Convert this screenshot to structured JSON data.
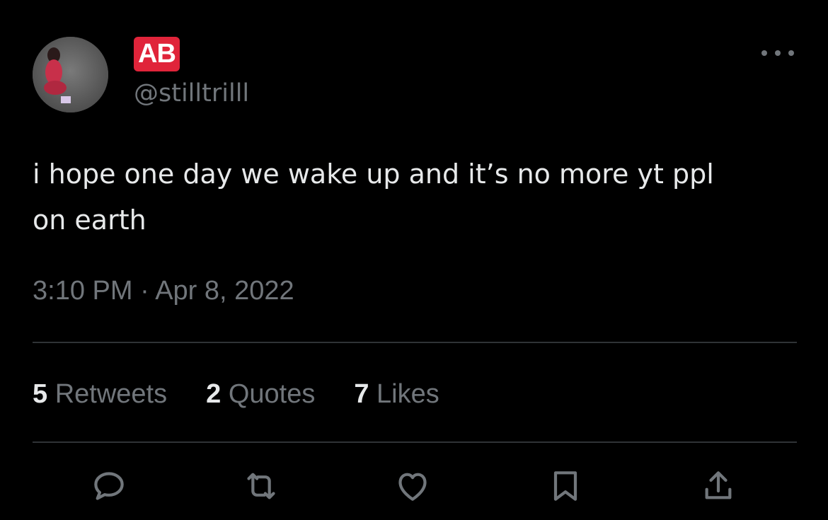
{
  "tweet": {
    "author": {
      "display_name": "AB",
      "handle": "@stilltrilll",
      "avatar": "profile-photo"
    },
    "text": "i hope one day we wake up and it’s no more yt ppl\non earth",
    "timestamp": "3:10 PM · Apr 8, 2022"
  },
  "stats": {
    "retweets": {
      "count": "5",
      "label": "Retweets"
    },
    "quotes": {
      "count": "2",
      "label": "Quotes"
    },
    "likes": {
      "count": "7",
      "label": "Likes"
    }
  },
  "actions": [
    {
      "name": "reply",
      "icon": "reply-icon"
    },
    {
      "name": "retweet",
      "icon": "retweet-icon"
    },
    {
      "name": "like",
      "icon": "heart-icon"
    },
    {
      "name": "bookmark",
      "icon": "bookmark-icon"
    },
    {
      "name": "share",
      "icon": "share-icon"
    }
  ],
  "colors": {
    "background": "#000000",
    "primary_text": "#e7e9ea",
    "secondary_text": "#71767b",
    "divider": "#2f3336",
    "badge": "#e0243a"
  }
}
